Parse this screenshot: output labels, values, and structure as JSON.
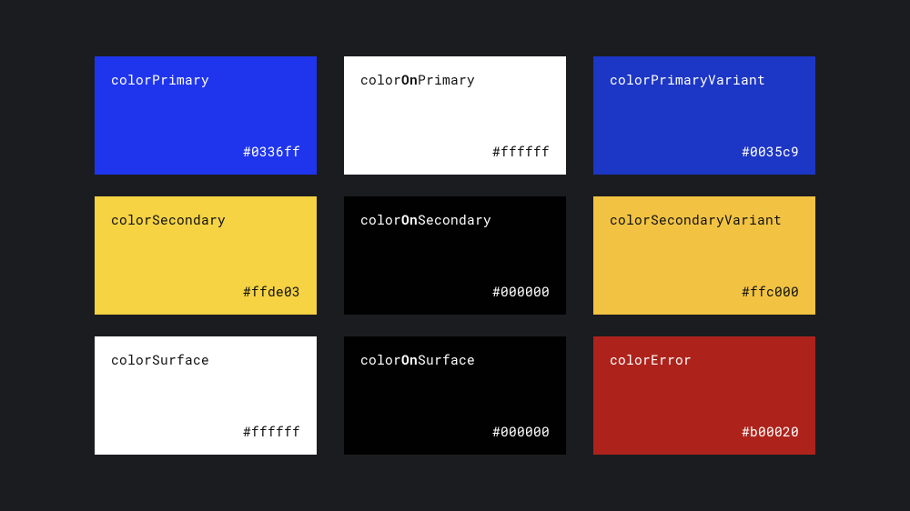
{
  "swatches": [
    {
      "nameHtml": "colorPrimary",
      "hex": "#0336ff",
      "bg": "#1f35ed",
      "text": "light"
    },
    {
      "nameHtml": "color<b>On</b>Primary",
      "hex": "#ffffff",
      "bg": "#ffffff",
      "text": "dark"
    },
    {
      "nameHtml": "colorPrimaryVariant",
      "hex": "#0035c9",
      "bg": "#1c36c5",
      "text": "light"
    },
    {
      "nameHtml": "colorSecondary",
      "hex": "#ffde03",
      "bg": "#f5d342",
      "text": "dark"
    },
    {
      "nameHtml": "color<b>On</b>Secondary",
      "hex": "#000000",
      "bg": "#010101",
      "text": "light"
    },
    {
      "nameHtml": "colorSecondaryVariant",
      "hex": "#ffc000",
      "bg": "#f2c342",
      "text": "dark"
    },
    {
      "nameHtml": "colorSurface",
      "hex": "#ffffff",
      "bg": "#ffffff",
      "text": "dark"
    },
    {
      "nameHtml": "color<b>On</b>Surface",
      "hex": "#000000",
      "bg": "#010101",
      "text": "light"
    },
    {
      "nameHtml": "colorError",
      "hex": "#b00020",
      "bg": "#ad231c",
      "text": "light"
    }
  ]
}
